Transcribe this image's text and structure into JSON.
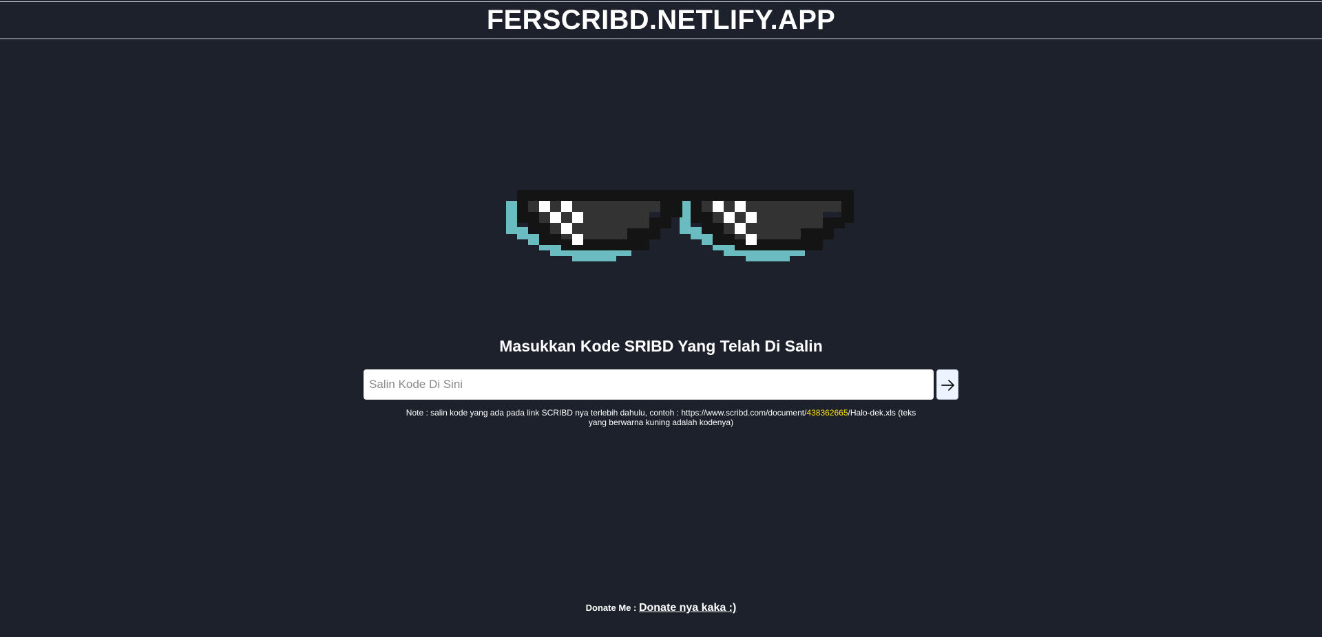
{
  "header": {
    "title": "FERSCRIBD.NETLIFY.APP"
  },
  "hero": {
    "image_icon": "pixel-sunglasses-icon"
  },
  "form": {
    "heading": "Masukkan Kode SRIBD Yang Telah Di Salin",
    "input_placeholder": "Salin Kode Di Sini",
    "input_value": "",
    "submit_icon": "arrow-right-icon"
  },
  "note": {
    "prefix": "Note : salin kode yang ada pada link SCRIBD nya terlebih dahulu, contoh : https://www.scribd.com/document/",
    "code": "438362665",
    "suffix": "/Halo-dek.xls (teks yang berwarna kuning adalah kodenya)"
  },
  "footer": {
    "donate_label": "Donate Me :",
    "donate_link": "Donate nya kaka :)"
  },
  "colors": {
    "background": "#1c212b",
    "text": "#ffffff",
    "highlight": "#ffe21a",
    "lens_shadow": "#6bbcc0"
  }
}
